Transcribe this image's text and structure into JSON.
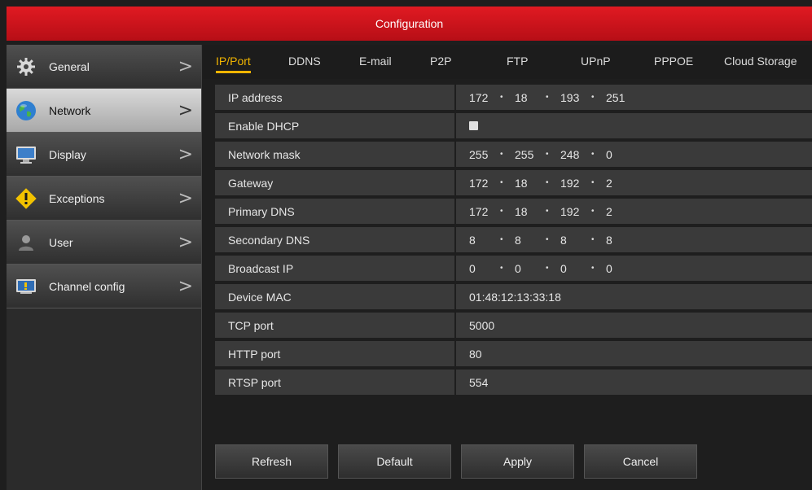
{
  "window": {
    "title": "Configuration"
  },
  "sidebar": {
    "items": [
      {
        "label": "General",
        "icon": "gear-icon",
        "active": false
      },
      {
        "label": "Network",
        "icon": "globe-icon",
        "active": true
      },
      {
        "label": "Display",
        "icon": "monitor-icon",
        "active": false
      },
      {
        "label": "Exceptions",
        "icon": "warning-icon",
        "active": false
      },
      {
        "label": "User",
        "icon": "user-icon",
        "active": false
      },
      {
        "label": "Channel config",
        "icon": "channel-icon",
        "active": false
      }
    ]
  },
  "tabs": [
    {
      "label": "IP/Port",
      "active": true
    },
    {
      "label": "DDNS",
      "active": false
    },
    {
      "label": "E-mail",
      "active": false
    },
    {
      "label": "P2P",
      "active": false
    },
    {
      "label": "FTP",
      "active": false
    },
    {
      "label": "UPnP",
      "active": false
    },
    {
      "label": "PPPOE",
      "active": false
    },
    {
      "label": "Cloud Storage",
      "active": false
    }
  ],
  "fields": {
    "ip_address": {
      "label": "IP address",
      "octets": [
        "172",
        "18",
        "193",
        "251"
      ]
    },
    "enable_dhcp": {
      "label": "Enable DHCP",
      "checked": false
    },
    "network_mask": {
      "label": "Network mask",
      "octets": [
        "255",
        "255",
        "248",
        "0"
      ]
    },
    "gateway": {
      "label": "Gateway",
      "octets": [
        "172",
        "18",
        "192",
        "2"
      ]
    },
    "primary_dns": {
      "label": "Primary DNS",
      "octets": [
        "172",
        "18",
        "192",
        "2"
      ]
    },
    "secondary_dns": {
      "label": "Secondary DNS",
      "octets": [
        "8",
        "8",
        "8",
        "8"
      ]
    },
    "broadcast_ip": {
      "label": "Broadcast IP",
      "octets": [
        "0",
        "0",
        "0",
        "0"
      ]
    },
    "device_mac": {
      "label": "Device MAC",
      "value": "01:48:12:13:33:18"
    },
    "tcp_port": {
      "label": "TCP port",
      "value": "5000"
    },
    "http_port": {
      "label": "HTTP port",
      "value": "80"
    },
    "rtsp_port": {
      "label": "RTSP port",
      "value": "554"
    }
  },
  "ip_separator": "•",
  "buttons": {
    "refresh": "Refresh",
    "default": "Default",
    "apply": "Apply",
    "cancel": "Cancel"
  },
  "chevron": ">",
  "colors": {
    "accent_red": "#d4141c",
    "active_tab": "#f0b400"
  }
}
